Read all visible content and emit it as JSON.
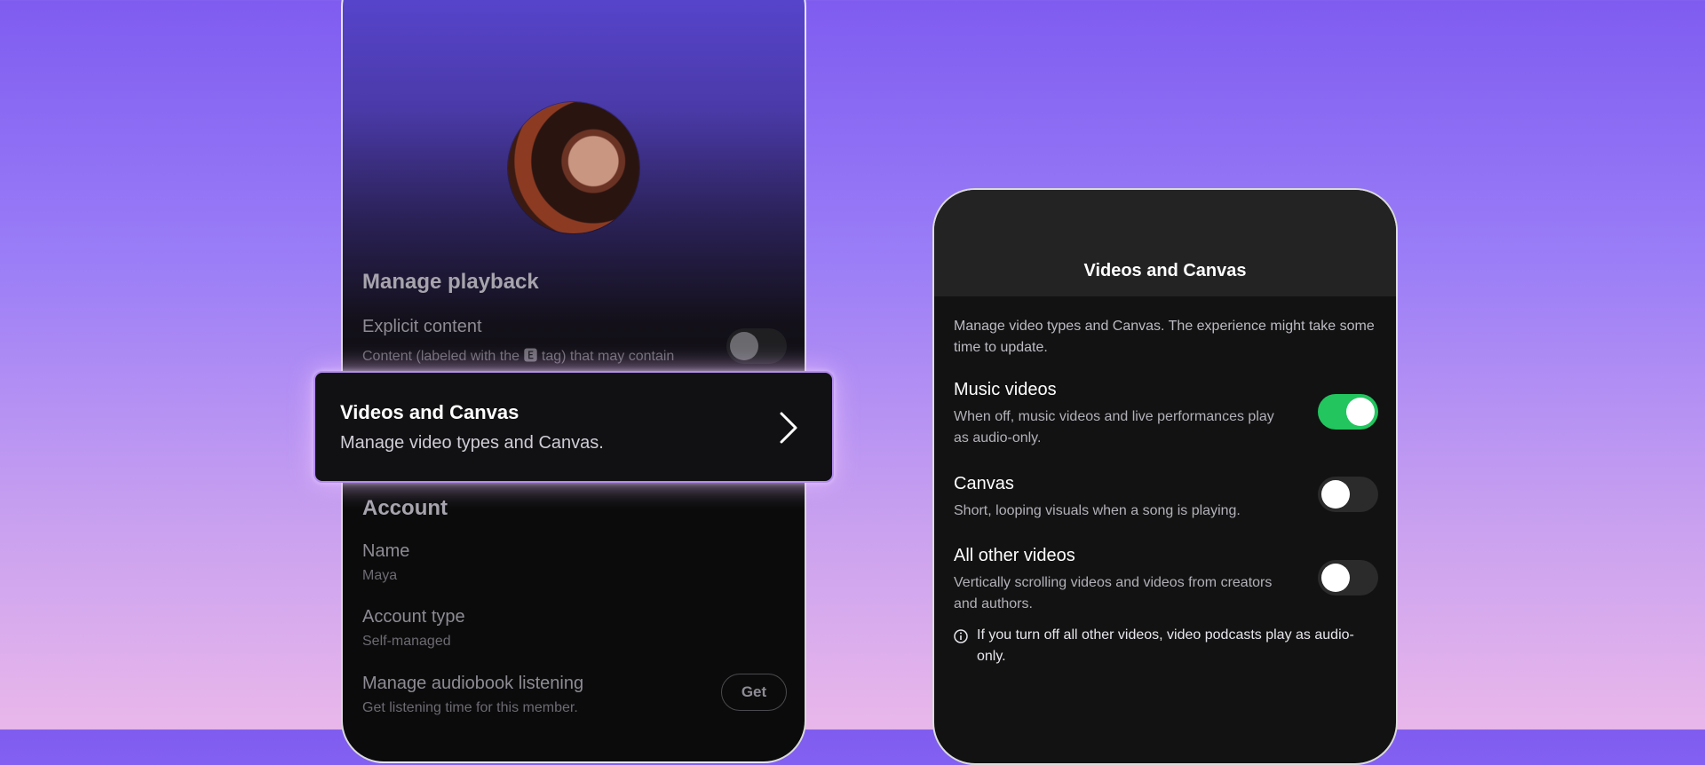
{
  "left_screen": {
    "section_playback": "Manage playback",
    "explicit": {
      "label": "Explicit content",
      "sub": "Content (labeled with the 🅴 tag) that may contain",
      "enabled": false
    },
    "section_account": "Account",
    "name": {
      "label": "Name",
      "value": "Maya"
    },
    "account_type": {
      "label": "Account type",
      "value": "Self-managed"
    },
    "audiobook": {
      "label": "Manage audiobook listening",
      "sub": "Get listening time for this member.",
      "button": "Get"
    }
  },
  "highlight_card": {
    "title": "Videos and Canvas",
    "subtitle": "Manage video types and Canvas."
  },
  "right_screen": {
    "title": "Videos and Canvas",
    "description": "Manage video types and Canvas. The experience might take some time to update.",
    "settings": [
      {
        "label": "Music videos",
        "sub": "When off, music videos and live performances play as audio-only.",
        "enabled": true
      },
      {
        "label": "Canvas",
        "sub": "Short, looping visuals when a song is playing.",
        "enabled": false
      },
      {
        "label": "All other videos",
        "sub": "Vertically scrolling videos and videos from creators and authors.",
        "enabled": false
      }
    ],
    "info_note": "If you turn off all other videos, video podcasts play as audio-only."
  },
  "colors": {
    "toggle_on": "#22c55e",
    "card_glow": "#b48cf0",
    "bg_top": "#7f5cf0",
    "bg_bottom": "#e9b7ea"
  }
}
